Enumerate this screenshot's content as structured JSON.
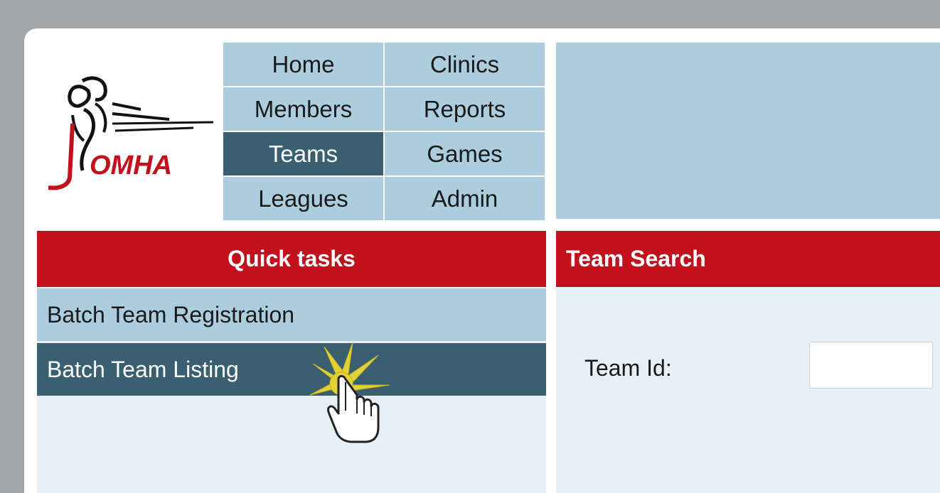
{
  "nav": {
    "items": [
      {
        "label": "Home",
        "active": false
      },
      {
        "label": "Clinics",
        "active": false
      },
      {
        "label": "Members",
        "active": false
      },
      {
        "label": "Reports",
        "active": false
      },
      {
        "label": "Teams",
        "active": true
      },
      {
        "label": "Games",
        "active": false
      },
      {
        "label": "Leagues",
        "active": false
      },
      {
        "label": "Admin",
        "active": false
      }
    ]
  },
  "logo": {
    "text": "OMHA"
  },
  "quick_tasks": {
    "title": "Quick tasks",
    "items": [
      {
        "label": "Batch Team Registration"
      },
      {
        "label": "Batch Team Listing"
      }
    ]
  },
  "team_search": {
    "title": "Team Search",
    "team_id_label": "Team Id:",
    "team_id_value": ""
  },
  "colors": {
    "nav_bg": "#abcddd",
    "nav_active": "#3a5f70",
    "header_red": "#c0111d",
    "panel_bg": "#e8f0f7"
  }
}
